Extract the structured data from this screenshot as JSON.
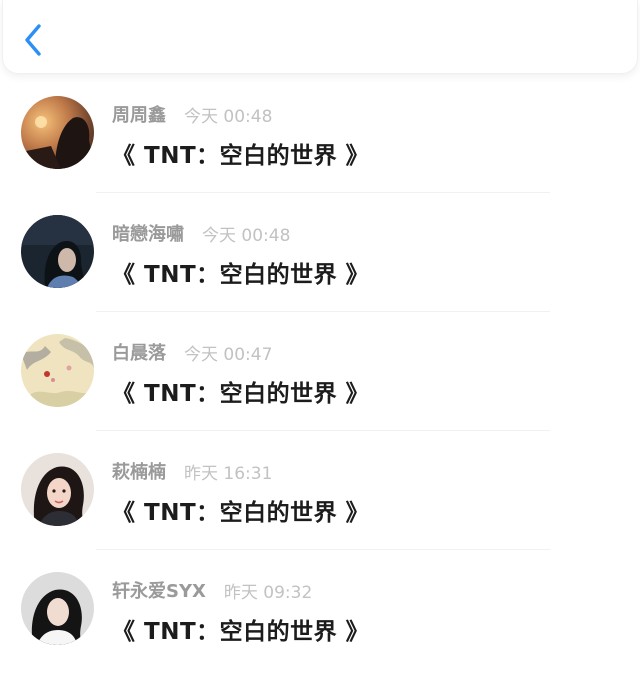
{
  "header": {
    "back_icon": "chevron-left-icon",
    "accent_color": "#2b8ff5"
  },
  "items": [
    {
      "name": "周周鑫",
      "time": "今天 00:48",
      "message": "《 TNT：空白的世界 》"
    },
    {
      "name": "暗戀海嘯",
      "time": "今天 00:48",
      "message": "《 TNT：空白的世界 》"
    },
    {
      "name": "白晨落",
      "time": "今天 00:47",
      "message": "《 TNT：空白的世界 》"
    },
    {
      "name": "萩楠楠",
      "time": "昨天 16:31",
      "message": "《 TNT：空白的世界 》"
    },
    {
      "name": "轩永爱SYX",
      "time": "昨天 09:32",
      "message": "《 TNT：空白的世界 》"
    }
  ]
}
